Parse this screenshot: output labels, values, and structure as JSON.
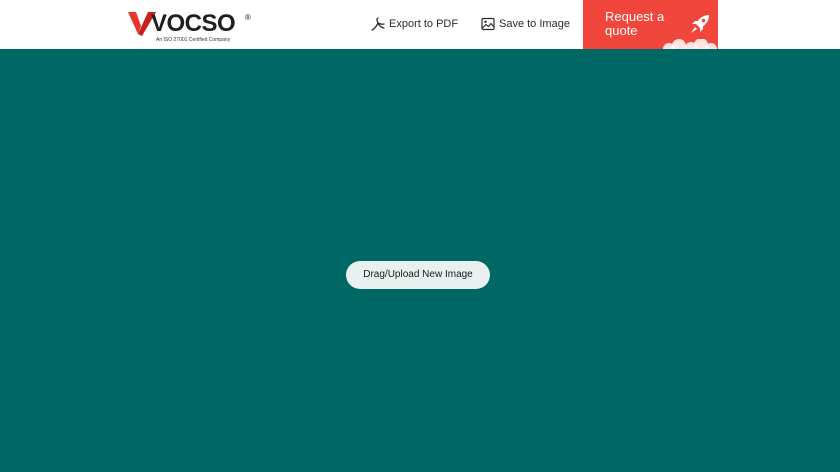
{
  "header": {
    "logo": {
      "wordmark": "VOCSO",
      "registered": "®",
      "tagline": "An ISO 27001 Certified Company"
    },
    "nav": {
      "export_label": "Export to PDF",
      "save_label": "Save to Image"
    },
    "quote_button": {
      "label": "Request a quote"
    }
  },
  "canvas": {
    "upload_label": "Drag/Upload New Image"
  },
  "icons": {
    "export": "pdf-icon",
    "save": "image-icon",
    "quote": "rocket-icon"
  },
  "colors": {
    "brand_red": "#f0463c",
    "canvas_teal": "#006864",
    "upload_button_bg": "#e8f1f0"
  }
}
